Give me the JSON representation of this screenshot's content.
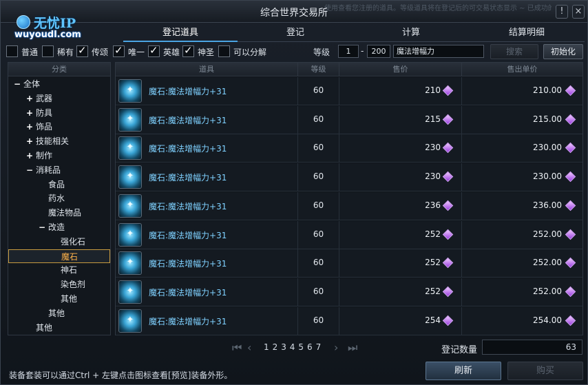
{
  "window": {
    "title": "综合世界交易所",
    "faded_hint": "使用查看您注册的道具。等级道具将在登记后的可交易状态显示 ∼ 已成功的交易的道具将会消失。",
    "help_label": "!",
    "close_label": "×"
  },
  "logo": {
    "name": "无忧IP",
    "url": "wuyoudl.com"
  },
  "tabs": [
    {
      "label": "登记道具",
      "active": true
    },
    {
      "label": "登记",
      "active": false
    },
    {
      "label": "计算",
      "active": false
    },
    {
      "label": "结算明细",
      "active": false
    }
  ],
  "filters": [
    {
      "label": "普通",
      "checked": false
    },
    {
      "label": "稀有",
      "checked": false
    },
    {
      "label": "传颂",
      "checked": true
    },
    {
      "label": "唯一",
      "checked": true
    },
    {
      "label": "英雄",
      "checked": true
    },
    {
      "label": "神圣",
      "checked": true
    },
    {
      "label": "可以分解",
      "checked": false
    }
  ],
  "level": {
    "label": "等级",
    "min": "1",
    "dash": "-",
    "max": "200"
  },
  "search": {
    "value": "魔法增幅力"
  },
  "buttons": {
    "search": "搜索",
    "reset": "初始化",
    "refresh": "刷新",
    "buy": "购买"
  },
  "tree": {
    "header": "分类",
    "items": [
      {
        "label": "全体",
        "prefix": "−",
        "level": 0
      },
      {
        "label": "武器",
        "prefix": "+",
        "level": 1
      },
      {
        "label": "防具",
        "prefix": "+",
        "level": 1
      },
      {
        "label": "饰品",
        "prefix": "+",
        "level": 1
      },
      {
        "label": "技能相关",
        "prefix": "+",
        "level": 1
      },
      {
        "label": "制作",
        "prefix": "+",
        "level": 1
      },
      {
        "label": "消耗品",
        "prefix": "−",
        "level": 1
      },
      {
        "label": "食品",
        "prefix": "",
        "level": 2
      },
      {
        "label": "药水",
        "prefix": "",
        "level": 2
      },
      {
        "label": "魔法物品",
        "prefix": "",
        "level": 2
      },
      {
        "label": "改造",
        "prefix": "−",
        "level": 2
      },
      {
        "label": "强化石",
        "prefix": "",
        "level": 3
      },
      {
        "label": "魔石",
        "prefix": "",
        "level": 3,
        "selected": true
      },
      {
        "label": "神石",
        "prefix": "",
        "level": 3
      },
      {
        "label": "染色剂",
        "prefix": "",
        "level": 3
      },
      {
        "label": "其他",
        "prefix": "",
        "level": 3
      },
      {
        "label": "其他",
        "prefix": "",
        "level": 2
      },
      {
        "label": "其他",
        "prefix": "",
        "level": 1
      }
    ]
  },
  "table": {
    "headers": [
      "道具",
      "等级",
      "售价",
      "售出单价"
    ],
    "rows": [
      {
        "name": "魔石:魔法增幅力+31",
        "level": "60",
        "price": "210",
        "unit_price": "210.00"
      },
      {
        "name": "魔石:魔法增幅力+31",
        "level": "60",
        "price": "215",
        "unit_price": "215.00"
      },
      {
        "name": "魔石:魔法增幅力+31",
        "level": "60",
        "price": "230",
        "unit_price": "230.00"
      },
      {
        "name": "魔石:魔法增幅力+31",
        "level": "60",
        "price": "230",
        "unit_price": "230.00"
      },
      {
        "name": "魔石:魔法增幅力+31",
        "level": "60",
        "price": "236",
        "unit_price": "236.00"
      },
      {
        "name": "魔石:魔法增幅力+31",
        "level": "60",
        "price": "252",
        "unit_price": "252.00"
      },
      {
        "name": "魔石:魔法增幅力+31",
        "level": "60",
        "price": "252",
        "unit_price": "252.00"
      },
      {
        "name": "魔石:魔法增幅力+31",
        "level": "60",
        "price": "252",
        "unit_price": "252.00"
      },
      {
        "name": "魔石:魔法增幅力+31",
        "level": "60",
        "price": "254",
        "unit_price": "254.00"
      }
    ]
  },
  "pagination": {
    "pages": [
      "1",
      "2",
      "3",
      "4",
      "5",
      "6",
      "7"
    ]
  },
  "count": {
    "label": "登记数量",
    "value": "63"
  },
  "hint": "装备套装可以通过Ctrl + 左键点击图标查看[预览]装备外形。"
}
